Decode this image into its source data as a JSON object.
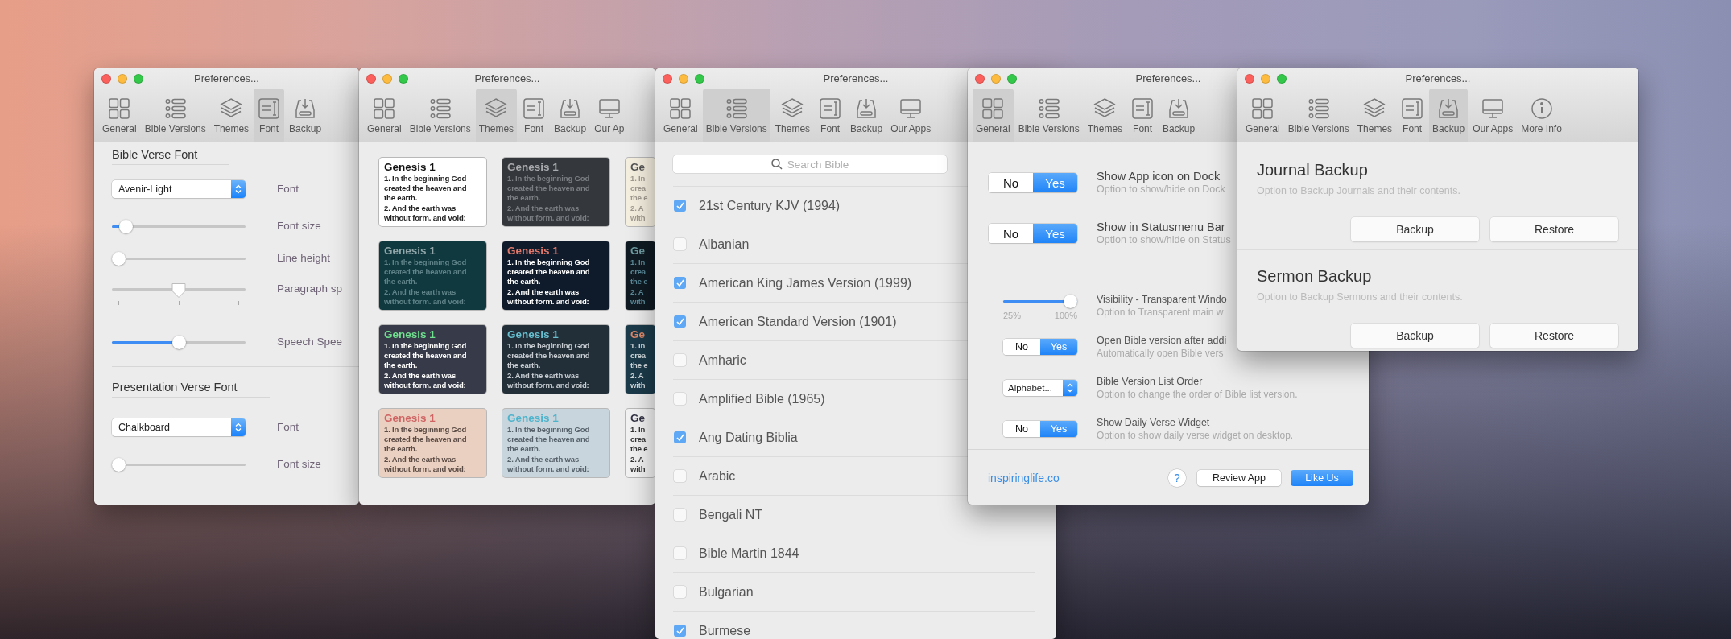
{
  "windows": [
    {
      "title": "Preferences...",
      "toolbar": [
        {
          "kind": "general",
          "label": "General",
          "selected": false
        },
        {
          "kind": "versions",
          "label": "Bible Versions",
          "selected": false
        },
        {
          "kind": "themes",
          "label": "Themes",
          "selected": false
        },
        {
          "kind": "font",
          "label": "Font",
          "selected": true
        },
        {
          "kind": "backup",
          "label": "Backup",
          "selected": false
        }
      ],
      "pane": {
        "kind": "font",
        "sections": [
          {
            "heading": "Bible Verse Font",
            "rows": [
              {
                "kind": "select",
                "value": "Avenir-Light",
                "label": "Font"
              },
              {
                "kind": "slider",
                "level": 0.06,
                "label": "Font size"
              },
              {
                "kind": "slider",
                "level": 0,
                "label": "Line height"
              },
              {
                "kind": "ticked-slider",
                "level": 0.5,
                "label": "Paragraph sp"
              },
              {
                "kind": "slider",
                "level": 0.5,
                "label": "Speech Spee"
              }
            ]
          },
          {
            "heading": "Presentation Verse Font",
            "rows": [
              {
                "kind": "select",
                "value": "Chalkboard",
                "label": "Font"
              },
              {
                "kind": "slider",
                "level": 0,
                "label": "Font size"
              }
            ]
          }
        ]
      }
    },
    {
      "title": "Preferences...",
      "toolbar": [
        {
          "kind": "general",
          "label": "General",
          "selected": false
        },
        {
          "kind": "versions",
          "label": "Bible Versions",
          "selected": false
        },
        {
          "kind": "themes",
          "label": "Themes",
          "selected": true
        },
        {
          "kind": "font",
          "label": "Font",
          "selected": false
        },
        {
          "kind": "backup",
          "label": "Backup",
          "selected": false
        },
        {
          "kind": "apps",
          "label": "Our Ap",
          "selected": false
        }
      ],
      "pane": {
        "kind": "themes",
        "cards": [
          {
            "color": "#ffffff",
            "title": {
              "text": "Genesis 1",
              "color": "#111111"
            },
            "verse": {
              "lines": [
                "1. In the beginning God",
                "created the heaven and",
                "the earth.",
                "2. And the earth was",
                "without form. and void:"
              ],
              "color": "#222222"
            }
          },
          {
            "color": "#34373b",
            "title": {
              "text": "Genesis 1",
              "color": "#a9abae"
            },
            "verse": {
              "lines": [
                "1. In the beginning God",
                "created the heaven and",
                "the earth.",
                "2. And the earth was",
                "without form. and void:"
              ],
              "color": "#7b7f84"
            }
          },
          {
            "color": "#f5efe0",
            "title": {
              "text": "Ge",
              "color": "#555555"
            },
            "verse": {
              "lines": [
                "1. In",
                "crea",
                "the e",
                "2. A",
                "with"
              ],
              "color": "#a09a90"
            }
          },
          {
            "color": "#10393f",
            "title": {
              "text": "Genesis 1",
              "color": "#8fa5a8"
            },
            "verse": {
              "lines": [
                "1. In the beginning God",
                "created the heaven and",
                "the earth.",
                "2. And the earth was",
                "without form. and void:"
              ],
              "color": "#5f8388"
            }
          },
          {
            "color": "#0f1a2a",
            "title": {
              "text": "Genesis 1",
              "color": "#e0786b"
            },
            "verse": {
              "lines": [
                "1. In the beginning God",
                "created the heaven and",
                "the earth.",
                "2. And the earth was",
                "without form. and void:"
              ],
              "color": "#ffffff"
            }
          },
          {
            "color": "#0f1a22",
            "title": {
              "text": "Ge",
              "color": "#6e9aa0"
            },
            "verse": {
              "lines": [
                "1. In",
                "crea",
                "the e",
                "2. A",
                "with"
              ],
              "color": "#5c8a9a"
            }
          },
          {
            "color": "#373a48",
            "title": {
              "text": "Genesis 1",
              "color": "#6fe08e"
            },
            "verse": {
              "lines": [
                "1. In the beginning God",
                "created the heaven and",
                "the earth.",
                "2. And the earth was",
                "without form. and void:"
              ],
              "color": "#ffffff"
            }
          },
          {
            "color": "#222f38",
            "title": {
              "text": "Genesis 1",
              "color": "#67bfcf"
            },
            "verse": {
              "lines": [
                "1. In the beginning God",
                "created the heaven and",
                "the earth.",
                "2. And the earth was",
                "without form. and void:"
              ],
              "color": "#c7cdd2"
            }
          },
          {
            "color": "#1b3a4a",
            "title": {
              "text": "Ge",
              "color": "#e08868"
            },
            "verse": {
              "lines": [
                "1. In",
                "crea",
                "the e",
                "2. A",
                "with"
              ],
              "color": "#d0d8dc"
            }
          },
          {
            "color": "#ead0c0",
            "title": {
              "text": "Genesis 1",
              "color": "#cf6464"
            },
            "verse": {
              "lines": [
                "1. In the beginning God",
                "created the heaven and",
                "the earth.",
                "2. And the earth was",
                "without form. and void:"
              ],
              "color": "#5a4a44"
            }
          },
          {
            "color": "#c9d5dc",
            "title": {
              "text": "Genesis 1",
              "color": "#4cb3cc"
            },
            "verse": {
              "lines": [
                "1. In the beginning God",
                "created the heaven and",
                "the earth.",
                "2. And the earth was",
                "without form. and void:"
              ],
              "color": "#55606a"
            }
          },
          {
            "color": "#f2f2f2",
            "title": {
              "text": "Ge",
              "color": "#333344"
            },
            "verse": {
              "lines": [
                "1. In",
                "crea",
                "the e",
                "2. A",
                "with"
              ],
              "color": "#333333"
            }
          }
        ]
      }
    },
    {
      "title": "Preferences...",
      "toolbar": [
        {
          "kind": "general",
          "label": "General",
          "selected": false
        },
        {
          "kind": "versions",
          "label": "Bible Versions",
          "selected": true
        },
        {
          "kind": "themes",
          "label": "Themes",
          "selected": false
        },
        {
          "kind": "font",
          "label": "Font",
          "selected": false
        },
        {
          "kind": "backup",
          "label": "Backup",
          "selected": false
        },
        {
          "kind": "apps",
          "label": "Our Apps",
          "selected": false
        }
      ],
      "pane": {
        "kind": "versions",
        "search": {
          "placeholder": "Search Bible"
        },
        "items": [
          {
            "label": "21st Century KJV (1994)",
            "checked": true
          },
          {
            "label": "Albanian",
            "checked": false
          },
          {
            "label": "American King James Version (1999)",
            "checked": true
          },
          {
            "label": "American Standard Version (1901)",
            "checked": true
          },
          {
            "label": "Amharic",
            "checked": false
          },
          {
            "label": "Amplified Bible (1965)",
            "checked": false
          },
          {
            "label": "Ang Dating Biblia",
            "checked": true
          },
          {
            "label": "Arabic",
            "checked": false
          },
          {
            "label": "Bengali NT",
            "checked": false
          },
          {
            "label": "Bible Martin 1844",
            "checked": false
          },
          {
            "label": "Bulgarian",
            "checked": false
          },
          {
            "label": "Burmese",
            "checked": true
          }
        ]
      }
    },
    {
      "title": "Preferences...",
      "toolbar": [
        {
          "kind": "general",
          "label": "General",
          "selected": true
        },
        {
          "kind": "versions",
          "label": "Bible Versions",
          "selected": false
        },
        {
          "kind": "themes",
          "label": "Themes",
          "selected": false
        },
        {
          "kind": "font",
          "label": "Font",
          "selected": false
        },
        {
          "kind": "backup",
          "label": "Backup",
          "selected": false
        }
      ],
      "pane": {
        "kind": "general",
        "main_settings": [
          {
            "kind": "toggle",
            "options": [
              {
                "label": "No",
                "selected": false
              },
              {
                "label": "Yes",
                "selected": true
              }
            ],
            "title": "Show App icon on Dock",
            "description": "Option to show/hide on Dock"
          },
          {
            "kind": "toggle",
            "options": [
              {
                "label": "No",
                "selected": false
              },
              {
                "label": "Yes",
                "selected": true
              }
            ],
            "title": "Show in Statusmenu Bar",
            "description": "Option to show/hide on Status"
          }
        ],
        "more_settings": [
          {
            "kind": "slider",
            "level": 1,
            "min_label": "25%",
            "max_label": "100%",
            "title": "Visibility - Transparent Windo",
            "description": "Option to Transparent main w"
          },
          {
            "kind": "toggle",
            "options": [
              {
                "label": "No",
                "selected": false
              },
              {
                "label": "Yes",
                "selected": true
              }
            ],
            "title": "Open Bible version after addi",
            "description": "Automatically open Bible vers"
          },
          {
            "kind": "select",
            "value": "Alphabet...",
            "title": "Bible Version List Order",
            "description": "Option to change the order of Bible list version."
          },
          {
            "kind": "toggle",
            "options": [
              {
                "label": "No",
                "selected": false
              },
              {
                "label": "Yes",
                "selected": true
              }
            ],
            "title": "Show Daily Verse Widget",
            "description": "Option to show daily verse widget on desktop."
          }
        ],
        "footer": {
          "link": "inspiringlife.co",
          "buttons": [
            {
              "kind": "help",
              "label": "?"
            },
            {
              "kind": "default",
              "label": "Review App"
            },
            {
              "kind": "primary",
              "label": "Like Us"
            }
          ]
        }
      }
    },
    {
      "title": "Preferences...",
      "toolbar": [
        {
          "kind": "general",
          "label": "General",
          "selected": false
        },
        {
          "kind": "versions",
          "label": "Bible Versions",
          "selected": false
        },
        {
          "kind": "themes",
          "label": "Themes",
          "selected": false
        },
        {
          "kind": "font",
          "label": "Font",
          "selected": false
        },
        {
          "kind": "backup",
          "label": "Backup",
          "selected": true
        },
        {
          "kind": "apps",
          "label": "Our Apps",
          "selected": false
        },
        {
          "kind": "info",
          "label": "More Info",
          "selected": false
        }
      ],
      "pane": {
        "kind": "backup",
        "sections": [
          {
            "heading": "Journal Backup",
            "description": "Option to Backup Journals and their contents.",
            "buttons": [
              "Backup",
              "Restore"
            ]
          },
          {
            "heading": "Sermon Backup",
            "description": "Option to Backup Sermons and their contents.",
            "buttons": [
              "Backup",
              "Restore"
            ]
          }
        ]
      }
    }
  ]
}
